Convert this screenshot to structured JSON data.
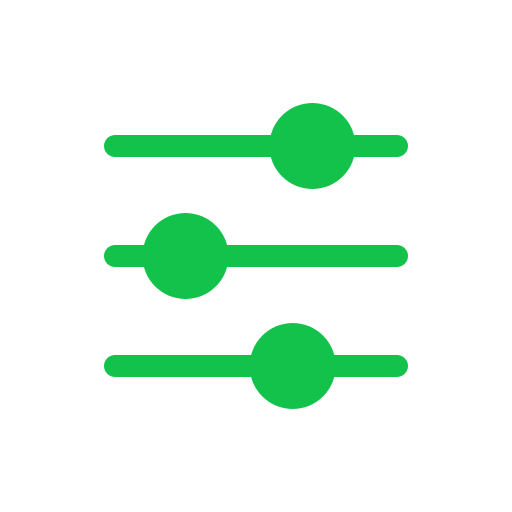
{
  "icon": {
    "name": "sliders-icon",
    "color": "#12C24A",
    "background": "#FFFFFF"
  },
  "sliders": [
    {
      "name": "slider-top",
      "level": 0.7
    },
    {
      "name": "slider-middle",
      "level": 0.25
    },
    {
      "name": "slider-bottom",
      "level": 0.63
    }
  ]
}
